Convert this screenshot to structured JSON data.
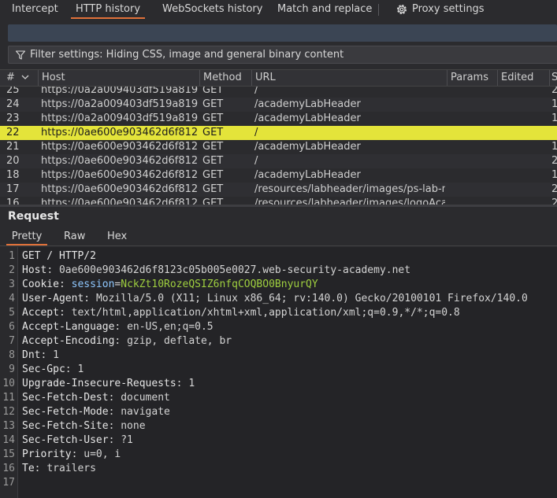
{
  "top_tabs": {
    "intercept": "Intercept",
    "http_history": "HTTP history",
    "websockets_history": "WebSockets history",
    "match_replace": "Match and replace",
    "proxy_settings": "Proxy settings"
  },
  "filter": {
    "text": "Filter settings: Hiding CSS, image and general binary content"
  },
  "table": {
    "headers": {
      "num": "#",
      "host": "Host",
      "method": "Method",
      "url": "URL",
      "params": "Params",
      "edited": "Edited",
      "status": "S"
    },
    "rows": [
      {
        "num": "25",
        "host": "https://0a2a009403df519a8191...",
        "method": "GET",
        "url": "/",
        "s": "2"
      },
      {
        "num": "24",
        "host": "https://0a2a009403df519a8191...",
        "method": "GET",
        "url": "/academyLabHeader",
        "s": "1"
      },
      {
        "num": "23",
        "host": "https://0a2a009403df519a8191...",
        "method": "GET",
        "url": "/academyLabHeader",
        "s": "1"
      },
      {
        "num": "22",
        "host": "https://0ae600e903462d6f8123...",
        "method": "GET",
        "url": "/",
        "s": ""
      },
      {
        "num": "21",
        "host": "https://0ae600e903462d6f8123...",
        "method": "GET",
        "url": "/academyLabHeader",
        "s": "1"
      },
      {
        "num": "20",
        "host": "https://0ae600e903462d6f8123...",
        "method": "GET",
        "url": "/",
        "s": "2"
      },
      {
        "num": "18",
        "host": "https://0ae600e903462d6f8123...",
        "method": "GET",
        "url": "/academyLabHeader",
        "s": "1"
      },
      {
        "num": "17",
        "host": "https://0ae600e903462d6f8123...",
        "method": "GET",
        "url": "/resources/labheader/images/ps-lab-no...",
        "s": "2"
      },
      {
        "num": "16",
        "host": "https://0ae600e903462d6f8123...",
        "method": "GET",
        "url": "/resources/labheader/images/logoAcad...",
        "s": "2"
      }
    ],
    "selected_num": "22"
  },
  "request": {
    "title": "Request",
    "tabs": {
      "pretty": "Pretty",
      "raw": "Raw",
      "hex": "Hex"
    },
    "lines": [
      {
        "n": "1",
        "name": "GET / HTTP/2",
        "sep": "",
        "value": ""
      },
      {
        "n": "2",
        "name": "Host",
        "sep": ": ",
        "value": "0ae600e903462d6f8123c05b005e0027.web-security-academy.net"
      },
      {
        "n": "3",
        "name": "Cookie",
        "sep": ": ",
        "value": "",
        "cookie_name": "session",
        "cookie_value": "NckZt10RozeQSIZ6nfqCOQBO0BnyurQY"
      },
      {
        "n": "4",
        "name": "User-Agent",
        "sep": ": ",
        "value": "Mozilla/5.0 (X11; Linux x86_64; rv:140.0) Gecko/20100101 Firefox/140.0"
      },
      {
        "n": "5",
        "name": "Accept",
        "sep": ": ",
        "value": "text/html,application/xhtml+xml,application/xml;q=0.9,*/*;q=0.8"
      },
      {
        "n": "6",
        "name": "Accept-Language",
        "sep": ": ",
        "value": "en-US,en;q=0.5"
      },
      {
        "n": "7",
        "name": "Accept-Encoding",
        "sep": ": ",
        "value": "gzip, deflate, br"
      },
      {
        "n": "8",
        "name": "Dnt",
        "sep": ": ",
        "value": "1"
      },
      {
        "n": "9",
        "name": "Sec-Gpc",
        "sep": ": ",
        "value": "1"
      },
      {
        "n": "10",
        "name": "Upgrade-Insecure-Requests",
        "sep": ": ",
        "value": "1"
      },
      {
        "n": "11",
        "name": "Sec-Fetch-Dest",
        "sep": ": ",
        "value": "document"
      },
      {
        "n": "12",
        "name": "Sec-Fetch-Mode",
        "sep": ": ",
        "value": "navigate"
      },
      {
        "n": "13",
        "name": "Sec-Fetch-Site",
        "sep": ": ",
        "value": "none"
      },
      {
        "n": "14",
        "name": "Sec-Fetch-User",
        "sep": ": ",
        "value": "?1"
      },
      {
        "n": "15",
        "name": "Priority",
        "sep": ": ",
        "value": "u=0, i"
      },
      {
        "n": "16",
        "name": "Te",
        "sep": ": ",
        "value": "trailers"
      },
      {
        "n": "17",
        "name": "",
        "sep": "",
        "value": ""
      }
    ]
  },
  "colors": {
    "accent": "#e0713a",
    "selected_row": "#e4e43a",
    "cookie_value": "#9fcf3f"
  }
}
